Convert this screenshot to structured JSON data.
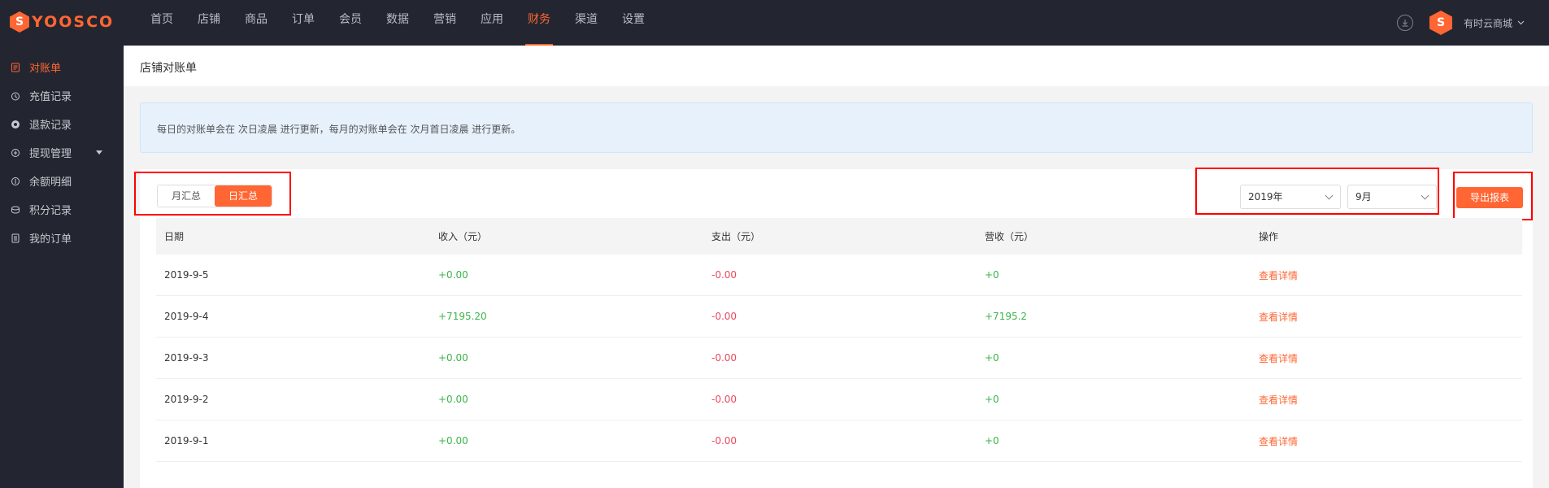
{
  "brand": {
    "logo_letter": "S",
    "name": "YOOSCO",
    "accent": "#ff6633"
  },
  "nav": {
    "items": [
      {
        "label": "首页"
      },
      {
        "label": "店铺"
      },
      {
        "label": "商品"
      },
      {
        "label": "订单"
      },
      {
        "label": "会员"
      },
      {
        "label": "数据"
      },
      {
        "label": "营销"
      },
      {
        "label": "应用"
      },
      {
        "label": "财务"
      },
      {
        "label": "渠道"
      },
      {
        "label": "设置"
      }
    ],
    "active": "财务"
  },
  "user": {
    "avatar_letter": "S",
    "shop_name": "有时云商城",
    "download_icon": "download-icon"
  },
  "sidebar": {
    "items": [
      {
        "label": "对账单",
        "icon": "statement-icon"
      },
      {
        "label": "充值记录",
        "icon": "recharge-icon"
      },
      {
        "label": "退款记录",
        "icon": "refund-icon"
      },
      {
        "label": "提现管理",
        "icon": "withdraw-icon"
      },
      {
        "label": "余额明细",
        "icon": "balance-icon"
      },
      {
        "label": "积分记录",
        "icon": "points-icon"
      },
      {
        "label": "我的订单",
        "icon": "orders-icon"
      }
    ]
  },
  "page": {
    "title": "店铺对账单",
    "notice": "每日的对账单会在 次日凌晨 进行更新，每月的对账单会在 次月首日凌晨 进行更新。"
  },
  "filters": {
    "toggle": {
      "monthly": "月汇总",
      "daily": "日汇总",
      "active": "日汇总"
    },
    "year": "2019年",
    "month": "9月",
    "export_label": "导出报表"
  },
  "table": {
    "headers": [
      "日期",
      "收入（元）",
      "支出（元）",
      "营收（元）",
      "操作"
    ],
    "rows": [
      {
        "date": "2019-9-5",
        "income": "+0.00",
        "expense": "-0.00",
        "revenue": "+0",
        "action": "查看详情"
      },
      {
        "date": "2019-9-4",
        "income": "+7195.20",
        "expense": "-0.00",
        "revenue": "+7195.2",
        "action": "查看详情"
      },
      {
        "date": "2019-9-3",
        "income": "+0.00",
        "expense": "-0.00",
        "revenue": "+0",
        "action": "查看详情"
      },
      {
        "date": "2019-9-2",
        "income": "+0.00",
        "expense": "-0.00",
        "revenue": "+0",
        "action": "查看详情"
      },
      {
        "date": "2019-9-1",
        "income": "+0.00",
        "expense": "-0.00",
        "revenue": "+0",
        "action": "查看详情"
      }
    ]
  },
  "colors": {
    "positive": "#3ab54a",
    "negative": "#e84a5f",
    "highlight": "#ff0000"
  }
}
